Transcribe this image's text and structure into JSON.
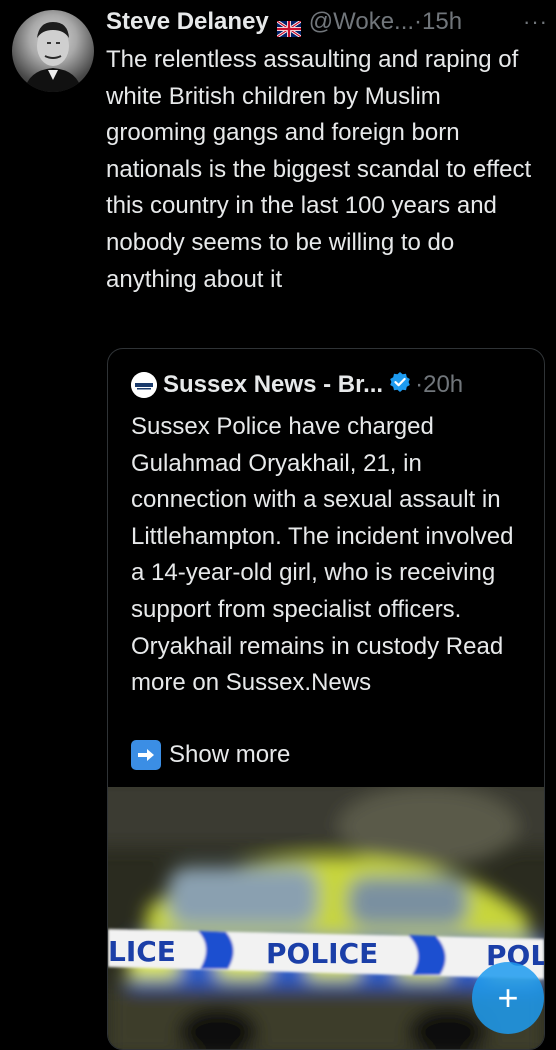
{
  "tweet": {
    "display_name": "Steve Delaney",
    "flag_icon": "uk-flag-icon",
    "handle": "@Woke...",
    "separator": "·",
    "time": "15h",
    "more_label": "···",
    "text": "The relentless assaulting and raping of white British children by Muslim grooming gangs and foreign born nationals is the biggest scandal to effect this country in the last 100 years and nobody seems to be willing to do anything about it"
  },
  "quoted": {
    "avatar_icon": "sussex-news-logo",
    "name": "Sussex News - Br...",
    "verified_icon": "verified-badge-icon",
    "separator": "·",
    "time": "20h",
    "text": "Sussex Police have charged Gulahmad Oryakhail, 21, in connection with a sexual assault in Littlehampton. The incident involved a 14-year-old girl, who is receiving support from specialist officers. Oryakhail remains in custody Read more on Sussex.News",
    "show_more_icon": "right-arrow-emoji-icon",
    "show_more_label": "Show more",
    "media": {
      "tape_texts": [
        "LICE",
        "POLICE",
        "POL"
      ]
    }
  },
  "compose_button": {
    "label": "+"
  },
  "colors": {
    "background": "#000000",
    "text": "#e7e9ea",
    "secondary": "#71767b",
    "border": "#2f3336",
    "accent": "#1d9bf0"
  }
}
